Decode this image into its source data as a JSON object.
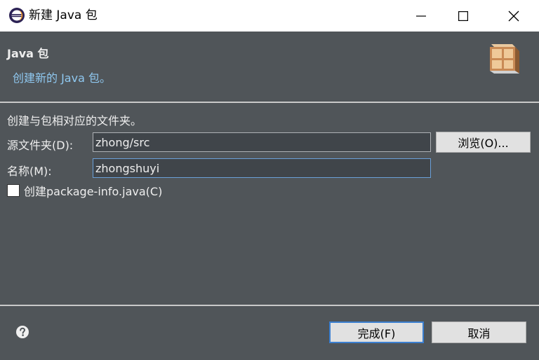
{
  "window": {
    "title": "新建 Java 包"
  },
  "header": {
    "title": "Java 包",
    "description": "创建新的 Java 包。"
  },
  "form": {
    "intro": "创建与包相对应的文件夹。",
    "source_folder_label": "源文件夹(D):",
    "source_folder_value": "zhong/src",
    "browse_label": "浏览(O)...",
    "name_label": "名称(M):",
    "name_value": "zhongshuyi",
    "create_package_info_label": "创建package-info.java(C)",
    "create_package_info_checked": false
  },
  "footer": {
    "finish_label": "完成(F)",
    "cancel_label": "取消"
  },
  "colors": {
    "dialog_bg": "#505559",
    "description_text": "#8fc8f0",
    "default_button_border": "#3b7fd0",
    "focused_input_border": "#6aa0d8"
  },
  "icons": {
    "app": "eclipse-icon",
    "minimize": "minimize-icon",
    "maximize": "maximize-icon",
    "close": "close-icon",
    "header": "package-icon",
    "help": "help-icon"
  }
}
